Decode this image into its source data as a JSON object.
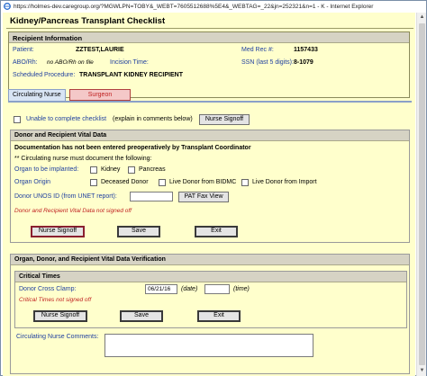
{
  "window": {
    "url": "https://holmes-dev.caregroup.org/?MGWLPN=TOBY&_WEBT=7605512688%5E4&_WEBTAG=_22&jn=252321&n=1 - K - Internet Explorer"
  },
  "page": {
    "title": "Kidney/Pancreas Transplant Checklist"
  },
  "recipient": {
    "header": "Recipient Information",
    "patient_label": "Patient:",
    "patient_value": "ZZTEST,LAURIE",
    "medrec_label": "Med Rec #:",
    "medrec_value": "1157433",
    "abo_label": "ABO/Rh:",
    "abo_value": "no ABO/Rh on file",
    "incision_label": "Incision Time:",
    "ssn_label": "SSN (last 5 digits):",
    "ssn_value": "8-1079",
    "procedure_label": "Scheduled Procedure:",
    "procedure_value": "TRANSPLANT KIDNEY RECIPIENT"
  },
  "tabs": {
    "circulating_nurse": "Circulating Nurse",
    "surgeon": "Surgeon"
  },
  "checklist": {
    "unable_label": "Unable to complete checklist",
    "unable_note": "(explain in comments below)",
    "nurse_signoff": "Nurse Signoff"
  },
  "donor_vitals": {
    "header": "Donor and Recipient Vital Data",
    "warning": "Documentation has not been entered preoperatively by Transplant Coordinator",
    "instruction": "** Circulating nurse must document the following:",
    "organ_label": "Organ to be implanted:",
    "kidney": "Kidney",
    "pancreas": "Pancreas",
    "origin_label": "Organ Origin",
    "deceased": "Deceased Donor",
    "live_bidmc": "Live Donor from BIDMC",
    "live_import": "Live Donor from Import",
    "unos_label": "Donor UNOS ID (from UNET report):",
    "pat_fax": "PAT Fax View",
    "not_signed": "Donor and Recipient Vital Data not signed off",
    "signoff": "Nurse Signoff",
    "save": "Save",
    "exit": "Exit"
  },
  "verification": {
    "header": "Organ, Donor, and Recipient Vital Data Verification",
    "critical_header": "Critical Times",
    "cross_clamp_label": "Donor Cross Clamp:",
    "date_value": "06/21/16",
    "date_hint": "(date)",
    "time_hint": "(time)",
    "not_signed": "Critical Times not signed off",
    "signoff": "Nurse Signoff",
    "save": "Save",
    "exit": "Exit"
  },
  "comments": {
    "label": "Circulating Nurse Comments:"
  }
}
